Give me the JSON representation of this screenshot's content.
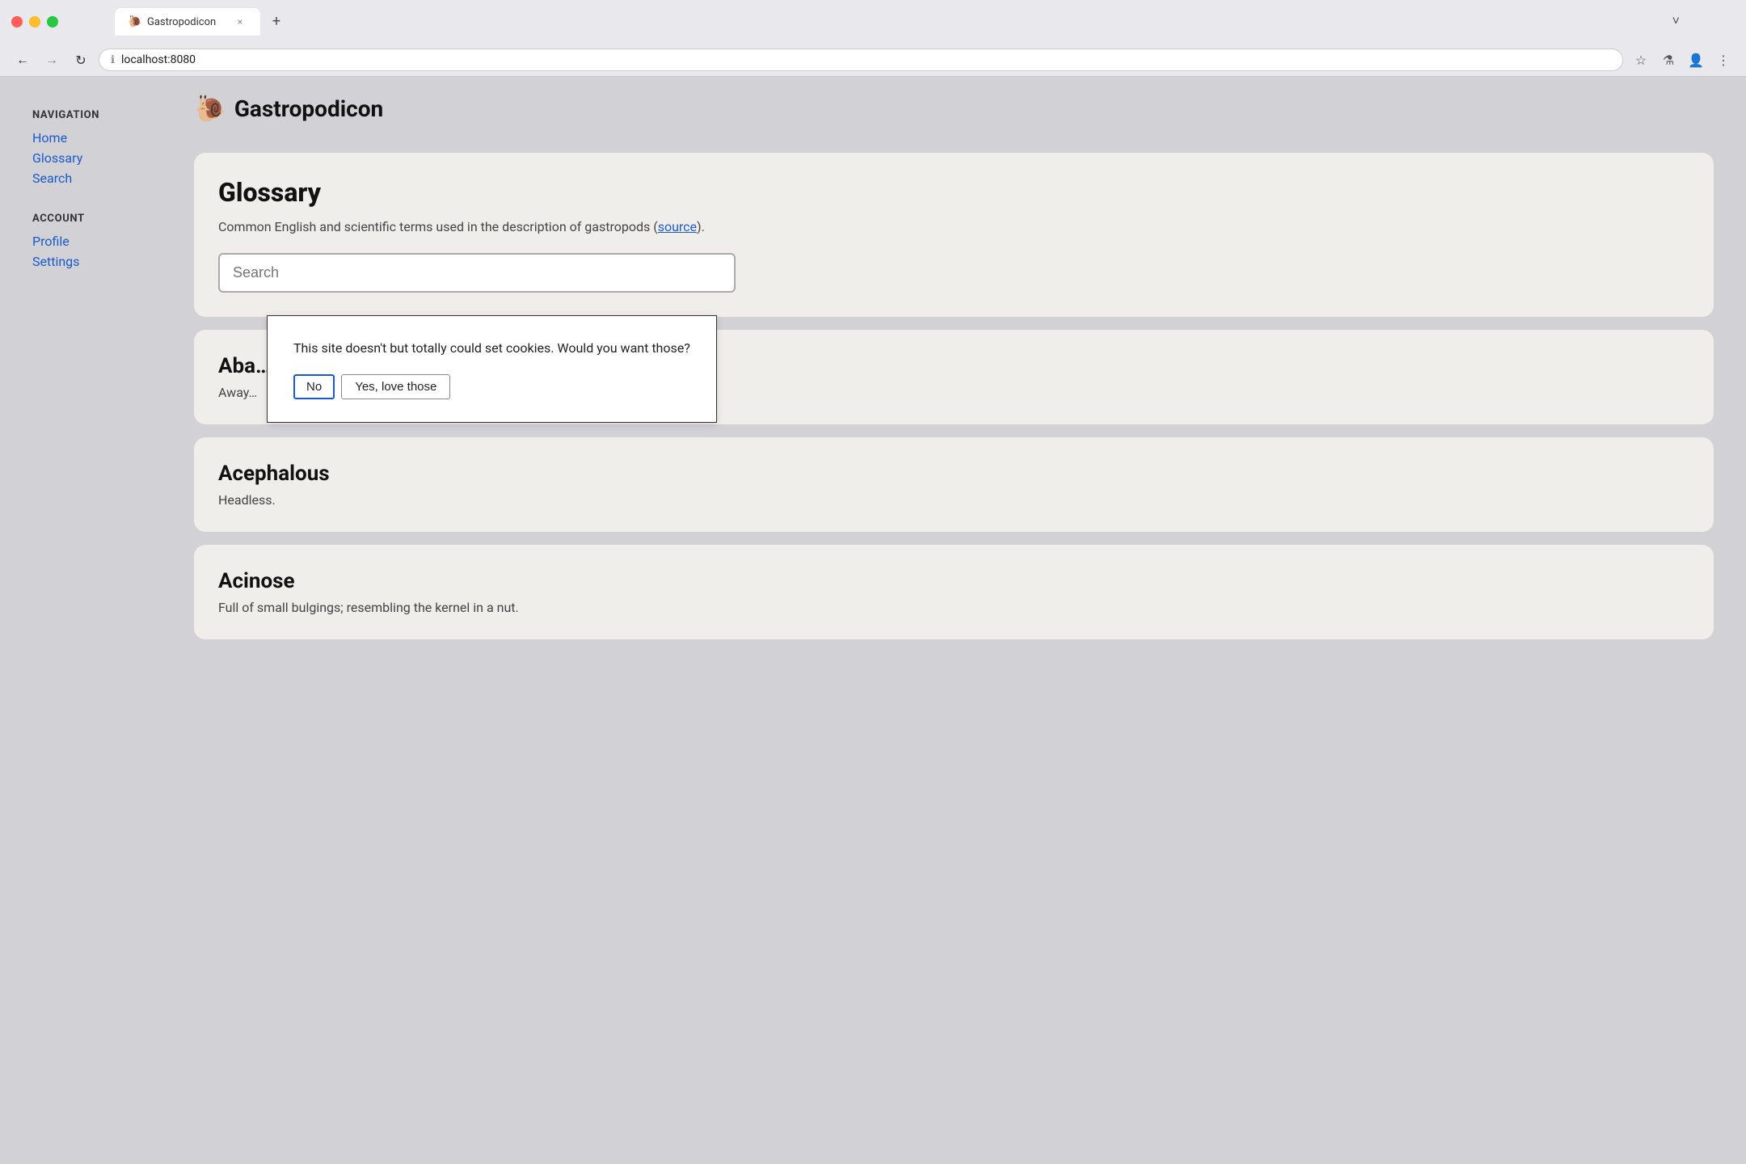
{
  "browser": {
    "tab_favicon": "🐌",
    "tab_title": "Gastropodicon",
    "tab_close": "×",
    "tab_new": "+",
    "tab_list_btn": "˅",
    "nav_back": "←",
    "nav_forward": "→",
    "nav_reload": "↻",
    "address_icon": "ℹ",
    "address_url": "localhost:8080",
    "toolbar_bookmark": "☆",
    "toolbar_experiment": "⚗",
    "toolbar_profile": "👤",
    "toolbar_menu": "⋮"
  },
  "site": {
    "logo": "🐌",
    "title": "Gastropodicon"
  },
  "sidebar": {
    "nav_heading": "NAVIGATION",
    "nav_links": [
      {
        "label": "Home",
        "href": "#"
      },
      {
        "label": "Glossary",
        "href": "#"
      },
      {
        "label": "Search",
        "href": "#"
      }
    ],
    "account_heading": "ACCOUNT",
    "account_links": [
      {
        "label": "Profile",
        "href": "#"
      },
      {
        "label": "Settings",
        "href": "#"
      }
    ]
  },
  "glossary": {
    "title": "Glossary",
    "description": "Common English and scientific terms used in the description of gastropods (",
    "source_link_text": "source",
    "description_end": ").",
    "search_placeholder": "Search",
    "terms": [
      {
        "term": "Aba…",
        "definition": "Away…"
      },
      {
        "term": "Acephalous",
        "definition": "Headless."
      },
      {
        "term": "Acinose",
        "definition": "Full of small bulgings; resembling the kernel in a nut."
      }
    ]
  },
  "cookie_dialog": {
    "message": "This site doesn't but totally could set cookies. Would you want those?",
    "btn_no": "No",
    "btn_yes": "Yes, love those"
  }
}
